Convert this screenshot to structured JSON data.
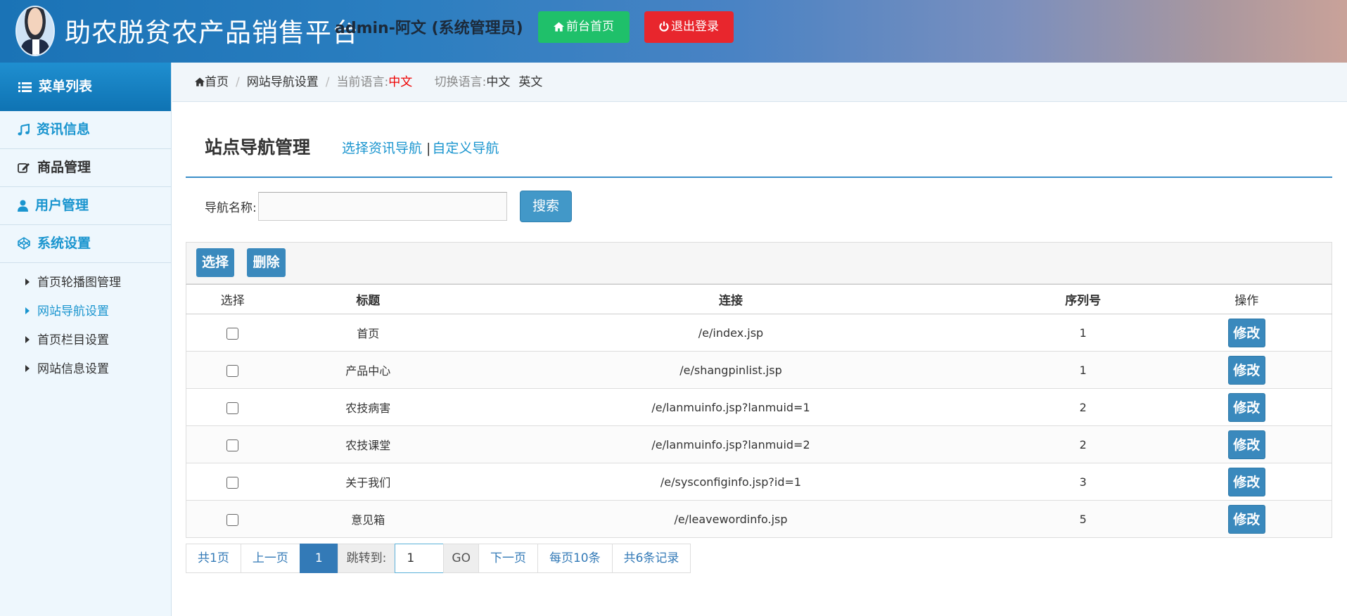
{
  "header": {
    "site_title": "助农脱贫农产品销售平台",
    "admin_info": "admin-阿文 (系统管理员)",
    "home_button": "前台首页",
    "logout_button": "退出登录"
  },
  "sidebar": {
    "menu_title": "菜单列表",
    "items": [
      {
        "label": "资讯信息",
        "icon": "music-icon"
      },
      {
        "label": "商品管理",
        "icon": "edit-icon"
      },
      {
        "label": "用户管理",
        "icon": "user-icon"
      },
      {
        "label": "系统设置",
        "icon": "codepen-icon"
      }
    ],
    "subitems": [
      "首页轮播图管理",
      "网站导航设置",
      "首页栏目设置",
      "网站信息设置"
    ],
    "active_subitem": 1
  },
  "breadcrumb": {
    "home": "首页",
    "current": "网站导航设置",
    "lang_label": "当前语言:",
    "lang_value": "中文",
    "switch_label": "切换语言:",
    "lang_zh": "中文",
    "lang_en": "英文"
  },
  "page": {
    "title": "站点导航管理",
    "link_select": "选择资讯导航",
    "link_custom": "自定义导航"
  },
  "search": {
    "label": "导航名称:",
    "value": "",
    "button": "搜索"
  },
  "toolbar": {
    "select_button": "选择",
    "delete_button": "删除"
  },
  "table": {
    "headers": [
      "选择",
      "标题",
      "连接",
      "序列号",
      "操作"
    ],
    "edit_label": "修改",
    "rows": [
      {
        "title": "首页",
        "link": "/e/index.jsp",
        "seq": "1"
      },
      {
        "title": "产品中心",
        "link": "/e/shangpinlist.jsp",
        "seq": "1"
      },
      {
        "title": "农技病害",
        "link": "/e/lanmuinfo.jsp?lanmuid=1",
        "seq": "2"
      },
      {
        "title": "农技课堂",
        "link": "/e/lanmuinfo.jsp?lanmuid=2",
        "seq": "2"
      },
      {
        "title": "关于我们",
        "link": "/e/sysconfiginfo.jsp?id=1",
        "seq": "3"
      },
      {
        "title": "意见箱",
        "link": "/e/leavewordinfo.jsp",
        "seq": "5"
      }
    ]
  },
  "pager": {
    "total_pages": "共1页",
    "prev": "上一页",
    "current_page": "1",
    "jump_label": "跳转到:",
    "jump_value": "1",
    "go": "GO",
    "next": "下一页",
    "per_page": "每页10条",
    "total_records": "共6条记录"
  },
  "colors": {
    "primary": "#1a95cf",
    "button": "#3a89bd",
    "home_green": "#1fc06a",
    "logout_red": "#e8262d"
  }
}
